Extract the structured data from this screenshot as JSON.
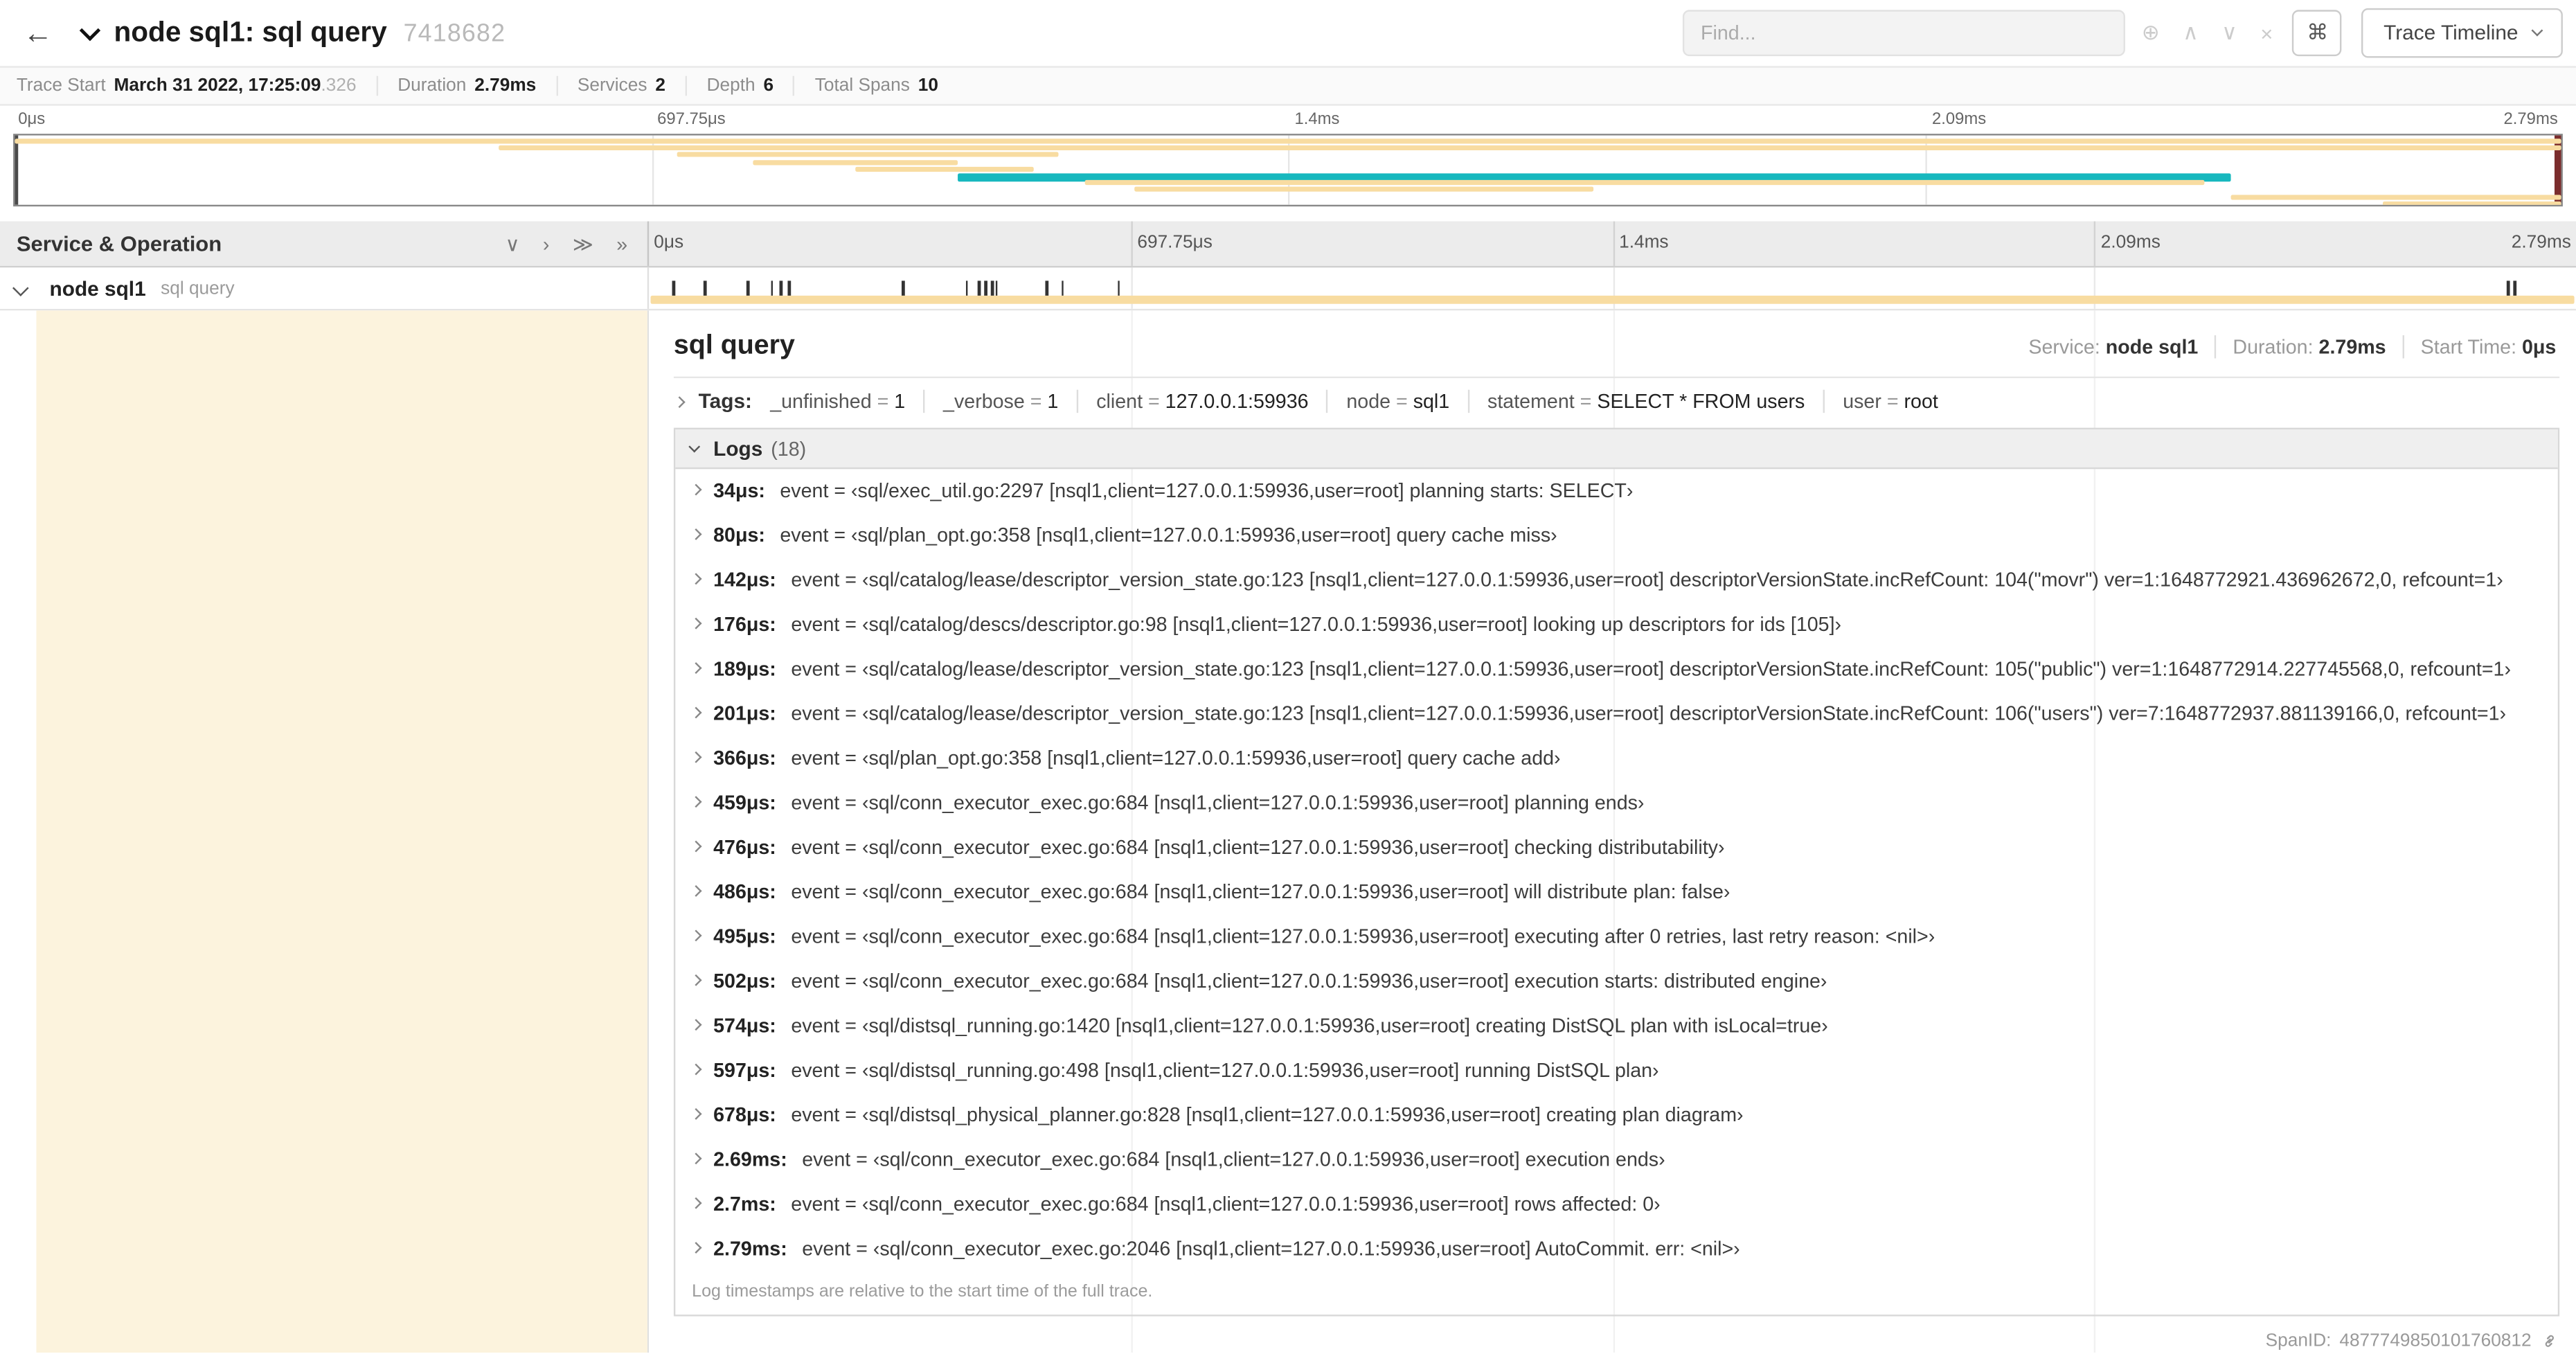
{
  "colors": {
    "span_tan": "#F8DCA1",
    "span_teal": "#17B8BE",
    "detail_band": "#FCF3DD",
    "cursor_guide": "#7B2D2D"
  },
  "icons": {
    "back": "←",
    "target": "⊕",
    "prev": "∧",
    "next": "∨",
    "clear": "×",
    "command": "⌘",
    "collapse_one": "∨",
    "expand_one": "›",
    "collapse_all": "≫",
    "expand_all": "»"
  },
  "header": {
    "title": "node sql1: sql query",
    "trace_id": "7418682",
    "find_placeholder": "Find...",
    "view_selector": "Trace Timeline"
  },
  "summary": {
    "items": [
      {
        "label": "Trace Start",
        "value": "March 31 2022, 17:25:09",
        "suffix": ".326"
      },
      {
        "label": "Duration",
        "value": "2.79ms"
      },
      {
        "label": "Services",
        "value": "2"
      },
      {
        "label": "Depth",
        "value": "6"
      },
      {
        "label": "Total Spans",
        "value": "10"
      }
    ]
  },
  "minimap": {
    "ticks": [
      "0μs",
      "697.75μs",
      "1.4ms",
      "2.09ms",
      "2.79ms"
    ],
    "spans": [
      {
        "row": 0,
        "start": 0,
        "end": 100,
        "c": "tan"
      },
      {
        "row": 1,
        "start": 19,
        "end": 100,
        "c": "tan"
      },
      {
        "row": 2,
        "start": 26,
        "end": 41,
        "c": "tan"
      },
      {
        "row": 3,
        "start": 29,
        "end": 37,
        "c": "tan"
      },
      {
        "row": 4,
        "start": 33,
        "end": 40,
        "c": "tan"
      },
      {
        "row": 5,
        "start": 37,
        "end": 87,
        "c": "teal"
      },
      {
        "row": 6,
        "start": 42,
        "end": 86,
        "c": "tan"
      },
      {
        "row": 7,
        "start": 44,
        "end": 62,
        "c": "tan"
      },
      {
        "row": 8,
        "start": 87,
        "end": 100,
        "c": "tan"
      },
      {
        "row": 9,
        "start": 93,
        "end": 100,
        "c": "tan"
      }
    ]
  },
  "timeline": {
    "left_header": "Service & Operation",
    "ticks": [
      "0μs",
      "697.75μs",
      "1.4ms",
      "2.09ms",
      "2.79ms"
    ],
    "duration_us": 2790,
    "row": {
      "service": "node sql1",
      "operation": "sql query"
    }
  },
  "detail": {
    "title": "sql query",
    "service_label": "Service:",
    "service": "node sql1",
    "duration_label": "Duration:",
    "duration": "2.79ms",
    "start_label": "Start Time:",
    "start": "0μs",
    "tags_label": "Tags:",
    "tags": [
      {
        "key": "_unfinished",
        "value": "1"
      },
      {
        "key": "_verbose",
        "value": "1"
      },
      {
        "key": "client",
        "value": "127.0.0.1:59936"
      },
      {
        "key": "node",
        "value": "sql1"
      },
      {
        "key": "statement",
        "value": "SELECT * FROM users"
      },
      {
        "key": "user",
        "value": "root"
      }
    ],
    "logs_label": "Logs",
    "logs_count": "(18)",
    "logs": [
      {
        "t": "34μs:",
        "us": 34,
        "msg": "event = ‹sql/exec_util.go:2297 [nsql1,client=127.0.0.1:59936,user=root] planning starts: SELECT›"
      },
      {
        "t": "80μs:",
        "us": 80,
        "msg": "event = ‹sql/plan_opt.go:358 [nsql1,client=127.0.0.1:59936,user=root] query cache miss›"
      },
      {
        "t": "142μs:",
        "us": 142,
        "msg": "event = ‹sql/catalog/lease/descriptor_version_state.go:123 [nsql1,client=127.0.0.1:59936,user=root] descriptorVersionState.incRefCount: 104(\"movr\") ver=1:1648772921.436962672,0, refcount=1›"
      },
      {
        "t": "176μs:",
        "us": 176,
        "msg": "event = ‹sql/catalog/descs/descriptor.go:98 [nsql1,client=127.0.0.1:59936,user=root] looking up descriptors for ids [105]›"
      },
      {
        "t": "189μs:",
        "us": 189,
        "msg": "event = ‹sql/catalog/lease/descriptor_version_state.go:123 [nsql1,client=127.0.0.1:59936,user=root] descriptorVersionState.incRefCount: 105(\"public\") ver=1:1648772914.227745568,0, refcount=1›"
      },
      {
        "t": "201μs:",
        "us": 201,
        "msg": "event = ‹sql/catalog/lease/descriptor_version_state.go:123 [nsql1,client=127.0.0.1:59936,user=root] descriptorVersionState.incRefCount: 106(\"users\") ver=7:1648772937.881139166,0, refcount=1›"
      },
      {
        "t": "366μs:",
        "us": 366,
        "msg": "event = ‹sql/plan_opt.go:358 [nsql1,client=127.0.0.1:59936,user=root] query cache add›"
      },
      {
        "t": "459μs:",
        "us": 459,
        "msg": "event = ‹sql/conn_executor_exec.go:684 [nsql1,client=127.0.0.1:59936,user=root] planning ends›"
      },
      {
        "t": "476μs:",
        "us": 476,
        "msg": "event = ‹sql/conn_executor_exec.go:684 [nsql1,client=127.0.0.1:59936,user=root] checking distributability›"
      },
      {
        "t": "486μs:",
        "us": 486,
        "msg": "event = ‹sql/conn_executor_exec.go:684 [nsql1,client=127.0.0.1:59936,user=root] will distribute plan: false›"
      },
      {
        "t": "495μs:",
        "us": 495,
        "msg": "event = ‹sql/conn_executor_exec.go:684 [nsql1,client=127.0.0.1:59936,user=root] executing after 0 retries, last retry reason: <nil>›"
      },
      {
        "t": "502μs:",
        "us": 502,
        "msg": "event = ‹sql/conn_executor_exec.go:684 [nsql1,client=127.0.0.1:59936,user=root] execution starts: distributed engine›"
      },
      {
        "t": "574μs:",
        "us": 574,
        "msg": "event = ‹sql/distsql_running.go:1420 [nsql1,client=127.0.0.1:59936,user=root] creating DistSQL plan with isLocal=true›"
      },
      {
        "t": "597μs:",
        "us": 597,
        "msg": "event = ‹sql/distsql_running.go:498 [nsql1,client=127.0.0.1:59936,user=root] running DistSQL plan›"
      },
      {
        "t": "678μs:",
        "us": 678,
        "msg": "event = ‹sql/distsql_physical_planner.go:828 [nsql1,client=127.0.0.1:59936,user=root] creating plan diagram›"
      },
      {
        "t": "2.69ms:",
        "us": 2690,
        "msg": "event = ‹sql/conn_executor_exec.go:684 [nsql1,client=127.0.0.1:59936,user=root] execution ends›"
      },
      {
        "t": "2.7ms:",
        "us": 2700,
        "msg": "event = ‹sql/conn_executor_exec.go:684 [nsql1,client=127.0.0.1:59936,user=root] rows affected: 0›"
      },
      {
        "t": "2.79ms:",
        "us": 2790,
        "msg": "event = ‹sql/conn_executor_exec.go:2046 [nsql1,client=127.0.0.1:59936,user=root] AutoCommit. err: <nil>›"
      }
    ],
    "footer_note": "Log timestamps are relative to the start time of the full trace.",
    "span_id_label": "SpanID:",
    "span_id": "4877749850101760812"
  }
}
